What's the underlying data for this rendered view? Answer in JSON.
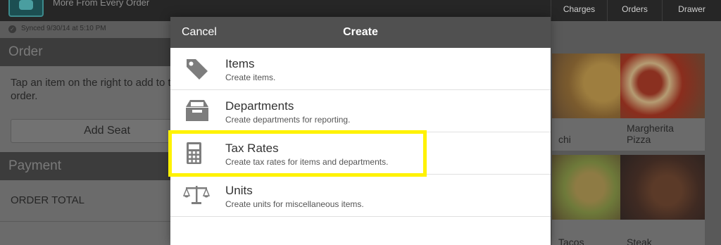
{
  "header": {
    "tagline": "More From Every Order",
    "nav": {
      "charges": "Charges",
      "orders": "Orders",
      "drawer": "Drawer"
    }
  },
  "sidebar": {
    "sync_status": "Synced 9/30/14 at 5:10 PM",
    "order_title": "Order",
    "order_hint": "Tap an item on the right to add to this order.",
    "add_seat": "Add Seat",
    "payment_title": "Payment",
    "order_total_label": "ORDER TOTAL"
  },
  "menu_grid": {
    "tiles": [
      {
        "label": "chi"
      },
      {
        "label": "Margherita Pizza"
      },
      {
        "label": "Tacos"
      },
      {
        "label": "Steak"
      }
    ]
  },
  "modal": {
    "cancel_label": "Cancel",
    "title": "Create",
    "items": [
      {
        "title": "Items",
        "subtitle": "Create items.",
        "icon": "tag-icon"
      },
      {
        "title": "Departments",
        "subtitle": "Create departments for reporting.",
        "icon": "tray-icon"
      },
      {
        "title": "Tax Rates",
        "subtitle": "Create tax rates for items and departments.",
        "icon": "calculator-icon",
        "highlighted": true
      },
      {
        "title": "Units",
        "subtitle": "Create units for miscellaneous items.",
        "icon": "scale-icon"
      }
    ]
  },
  "colors": {
    "modal_header": "#505050",
    "highlight": "#fff200",
    "overlay_panel": "#6b6b6b"
  }
}
